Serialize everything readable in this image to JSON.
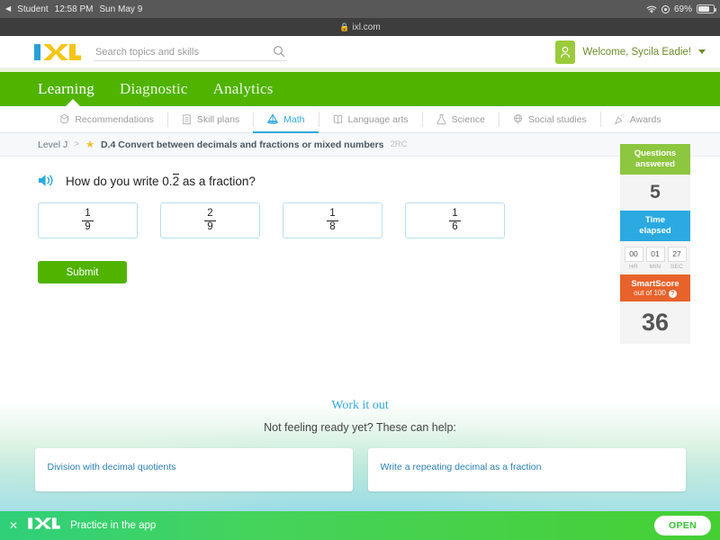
{
  "status_bar": {
    "back_label": "Student",
    "time": "12:58 PM",
    "date": "Sun May 9",
    "battery_percent": "69%",
    "wifi_icon": "wifi-icon",
    "location_icon": "location-icon",
    "battery_icon": "battery-icon"
  },
  "url_bar": {
    "lock_icon": "lock-icon",
    "url": "ixl.com"
  },
  "header": {
    "logo_text": "IXL",
    "search_placeholder": "Search topics and skills",
    "search_value": "",
    "search_icon": "search-icon",
    "avatar_icon": "user-avatar-icon",
    "welcome": "Welcome, Sycila Eadie!",
    "caret_icon": "chevron-down-icon"
  },
  "green_nav": {
    "items": [
      {
        "label": "Learning",
        "active": true
      },
      {
        "label": "Diagnostic",
        "active": false
      },
      {
        "label": "Analytics",
        "active": false
      }
    ]
  },
  "subjects": {
    "items": [
      {
        "label": "Recommendations",
        "icon": "recommendations-icon",
        "active": false
      },
      {
        "label": "Skill plans",
        "icon": "skill-plans-icon",
        "active": false
      },
      {
        "label": "Math",
        "icon": "math-icon",
        "active": true
      },
      {
        "label": "Language arts",
        "icon": "language-arts-icon",
        "active": false
      },
      {
        "label": "Science",
        "icon": "science-icon",
        "active": false
      },
      {
        "label": "Social studies",
        "icon": "social-studies-icon",
        "active": false
      },
      {
        "label": "Awards",
        "icon": "awards-icon",
        "active": false
      }
    ]
  },
  "breadcrumb": {
    "level": "Level J",
    "separator": ">",
    "star_icon": "star-icon",
    "skill_title": "D.4 Convert between decimals and fractions or mixed numbers",
    "skill_code": "2RC"
  },
  "question": {
    "speaker_icon": "speaker-icon",
    "text_before": "How do you write 0.",
    "repeating_digit": "2",
    "text_after": " as a fraction?",
    "choices": [
      {
        "numerator": "1",
        "denominator": "9"
      },
      {
        "numerator": "2",
        "denominator": "9"
      },
      {
        "numerator": "1",
        "denominator": "8"
      },
      {
        "numerator": "1",
        "denominator": "6"
      }
    ],
    "submit_label": "Submit"
  },
  "sidebar": {
    "questions_answered": {
      "title_line1": "Questions",
      "title_line2": "answered",
      "value": "5"
    },
    "time_elapsed": {
      "title_line1": "Time",
      "title_line2": "elapsed",
      "hr": "00",
      "min": "01",
      "sec": "27",
      "hr_label": "HR",
      "min_label": "MIN",
      "sec_label": "SEC"
    },
    "smartscore": {
      "title": "SmartScore",
      "subtitle": "out of 100",
      "help_icon": "help-icon",
      "value": "36"
    }
  },
  "work_it_out": {
    "title": "Work it out",
    "subtitle": "Not feeling ready yet? These can help:",
    "cards": [
      {
        "label": "Division with decimal quotients"
      },
      {
        "label": "Write a repeating decimal as a fraction"
      }
    ]
  },
  "app_banner": {
    "close_icon": "close-icon",
    "logo_text": "IXL",
    "text": "Practice in the app",
    "open_label": "OPEN"
  },
  "colors": {
    "brand_green": "#4fb300",
    "accent_blue": "#2fa8dd",
    "sidebar_green": "#8dc63f",
    "sidebar_blue": "#2aaae1",
    "sidebar_orange": "#e8622c",
    "logo_blue": "#2a9fd6",
    "logo_yellow": "#f5c518"
  }
}
